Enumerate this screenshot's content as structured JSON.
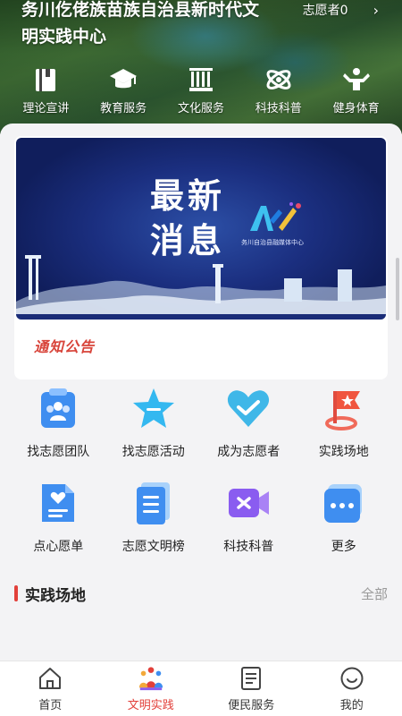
{
  "header": {
    "title": "务川仡佬族苗族自治县新时代文明实践中心",
    "volunteer_label": "志愿者0",
    "chevron": "›",
    "quick_nav": [
      {
        "label": "理论宣讲",
        "icon": "book-icon"
      },
      {
        "label": "教育服务",
        "icon": "graduation-cap-icon"
      },
      {
        "label": "文化服务",
        "icon": "cultural-building-icon"
      },
      {
        "label": "科技科普",
        "icon": "atom-icon"
      },
      {
        "label": "健身体育",
        "icon": "fitness-icon"
      }
    ]
  },
  "news": {
    "banner_line1": "最新",
    "banner_line2": "消息",
    "logo_caption": "务川自治县融媒体中心",
    "notice_tag": "通知公告"
  },
  "grid": {
    "items": [
      {
        "label": "找志愿团队",
        "icon": "team-icon"
      },
      {
        "label": "找志愿活动",
        "icon": "star-icon"
      },
      {
        "label": "成为志愿者",
        "icon": "heart-icon"
      },
      {
        "label": "实践场地",
        "icon": "location-flag-icon"
      },
      {
        "label": "点心愿单",
        "icon": "wish-doc-icon"
      },
      {
        "label": "志愿文明榜",
        "icon": "list-doc-icon"
      },
      {
        "label": "科技科普",
        "icon": "video-icon"
      },
      {
        "label": "更多",
        "icon": "more-icon"
      }
    ]
  },
  "section": {
    "title": "实践场地",
    "more": "全部"
  },
  "tabbar": {
    "tabs": [
      {
        "label": "首页",
        "icon": "home-icon"
      },
      {
        "label": "文明实践",
        "icon": "people-icon"
      },
      {
        "label": "便民服务",
        "icon": "document-icon"
      },
      {
        "label": "我的",
        "icon": "profile-icon"
      }
    ],
    "active_color": "#e2403a"
  }
}
